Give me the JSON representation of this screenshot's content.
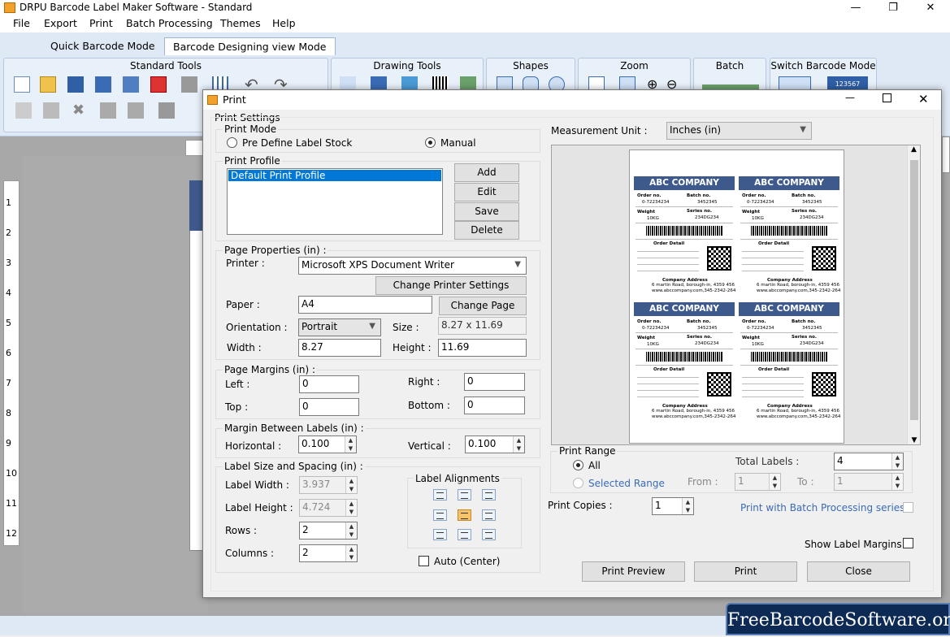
{
  "app": {
    "title": "DRPU Barcode Label Maker Software - Standard",
    "menu": [
      "File",
      "Export",
      "Print",
      "Batch Processing",
      "Themes",
      "Help"
    ],
    "tabs": [
      "Quick Barcode Mode",
      "Barcode Designing view Mode"
    ],
    "ribbon_groups": [
      "Standard Tools",
      "Drawing Tools",
      "Shapes",
      "Zoom",
      "Batch",
      "Switch Barcode Mode"
    ],
    "ribbon_badge": "123567",
    "ruler": [
      "1",
      "2",
      "3",
      "4",
      "5",
      "6",
      "7",
      "8",
      "9",
      "10",
      "11",
      "12"
    ],
    "watermark": "FreeBarcodeSoftware.org"
  },
  "dialog": {
    "title": "Print",
    "print_settings": "Print Settings",
    "print_mode": {
      "legend": "Print Mode",
      "opt1": "Pre Define Label Stock",
      "opt2": "Manual"
    },
    "print_profile": {
      "legend": "Print Profile",
      "selected": "Default Print Profile",
      "add": "Add",
      "edit": "Edit",
      "save": "Save",
      "delete": "Delete"
    },
    "page_properties": {
      "legend": "Page Properties (in) :",
      "printer_label": "Printer :",
      "printer": "Microsoft XPS Document Writer",
      "change_printer": "Change Printer Settings",
      "paper_label": "Paper :",
      "paper": "A4",
      "change_page": "Change Page",
      "orientation_label": "Orientation :",
      "orientation": "Portrait",
      "size_label": "Size :",
      "size": "8.27 x 11.69",
      "width_label": "Width :",
      "width": "8.27",
      "height_label": "Height :",
      "height": "11.69"
    },
    "page_margins": {
      "legend": "Page Margins (in) :",
      "left_label": "Left :",
      "left": "0",
      "right_label": "Right :",
      "right": "0",
      "top_label": "Top :",
      "top": "0",
      "bottom_label": "Bottom :",
      "bottom": "0"
    },
    "margin_between": {
      "legend": "Margin Between Labels (in) :",
      "h_label": "Horizontal :",
      "h": "0.100",
      "v_label": "Vertical :",
      "v": "0.100"
    },
    "label_size": {
      "legend": "Label Size and Spacing (in) :",
      "w_label": "Label Width :",
      "w": "3.937",
      "h_label": "Label Height :",
      "h": "4.724",
      "rows_label": "Rows :",
      "rows": "2",
      "cols_label": "Columns :",
      "cols": "2",
      "align_legend": "Label Alignments",
      "auto": "Auto (Center)"
    },
    "measurement": {
      "label": "Measurement Unit :",
      "value": "Inches (in)"
    },
    "print_range": {
      "legend": "Print Range",
      "all": "All",
      "selected": "Selected Range",
      "from_label": "From :",
      "from": "1",
      "to_label": "To :",
      "to": "1",
      "total_label": "Total Labels :",
      "total": "4"
    },
    "copies": {
      "label": "Print Copies :",
      "value": "1"
    },
    "batch_series": "Print with Batch Processing series",
    "show_margins": "Show Label Margins",
    "buttons": {
      "preview": "Print Preview",
      "print": "Print",
      "close": "Close"
    }
  },
  "label": {
    "company": "ABC COMPANY",
    "order_no": "Order no.",
    "order_val": "0-72234234",
    "batch_no": "Batch no.",
    "batch_val": "3452345",
    "weight": "Weight",
    "weight_val": "10KG",
    "series_no": "Series no.",
    "series_val": "234DG234",
    "order_detail": "Order Detail",
    "addr_title": "Company Address",
    "addr1": "6 martin Road, borough-in, 4359 456",
    "addr2": "www.abccompany.com,345-2342-264"
  }
}
